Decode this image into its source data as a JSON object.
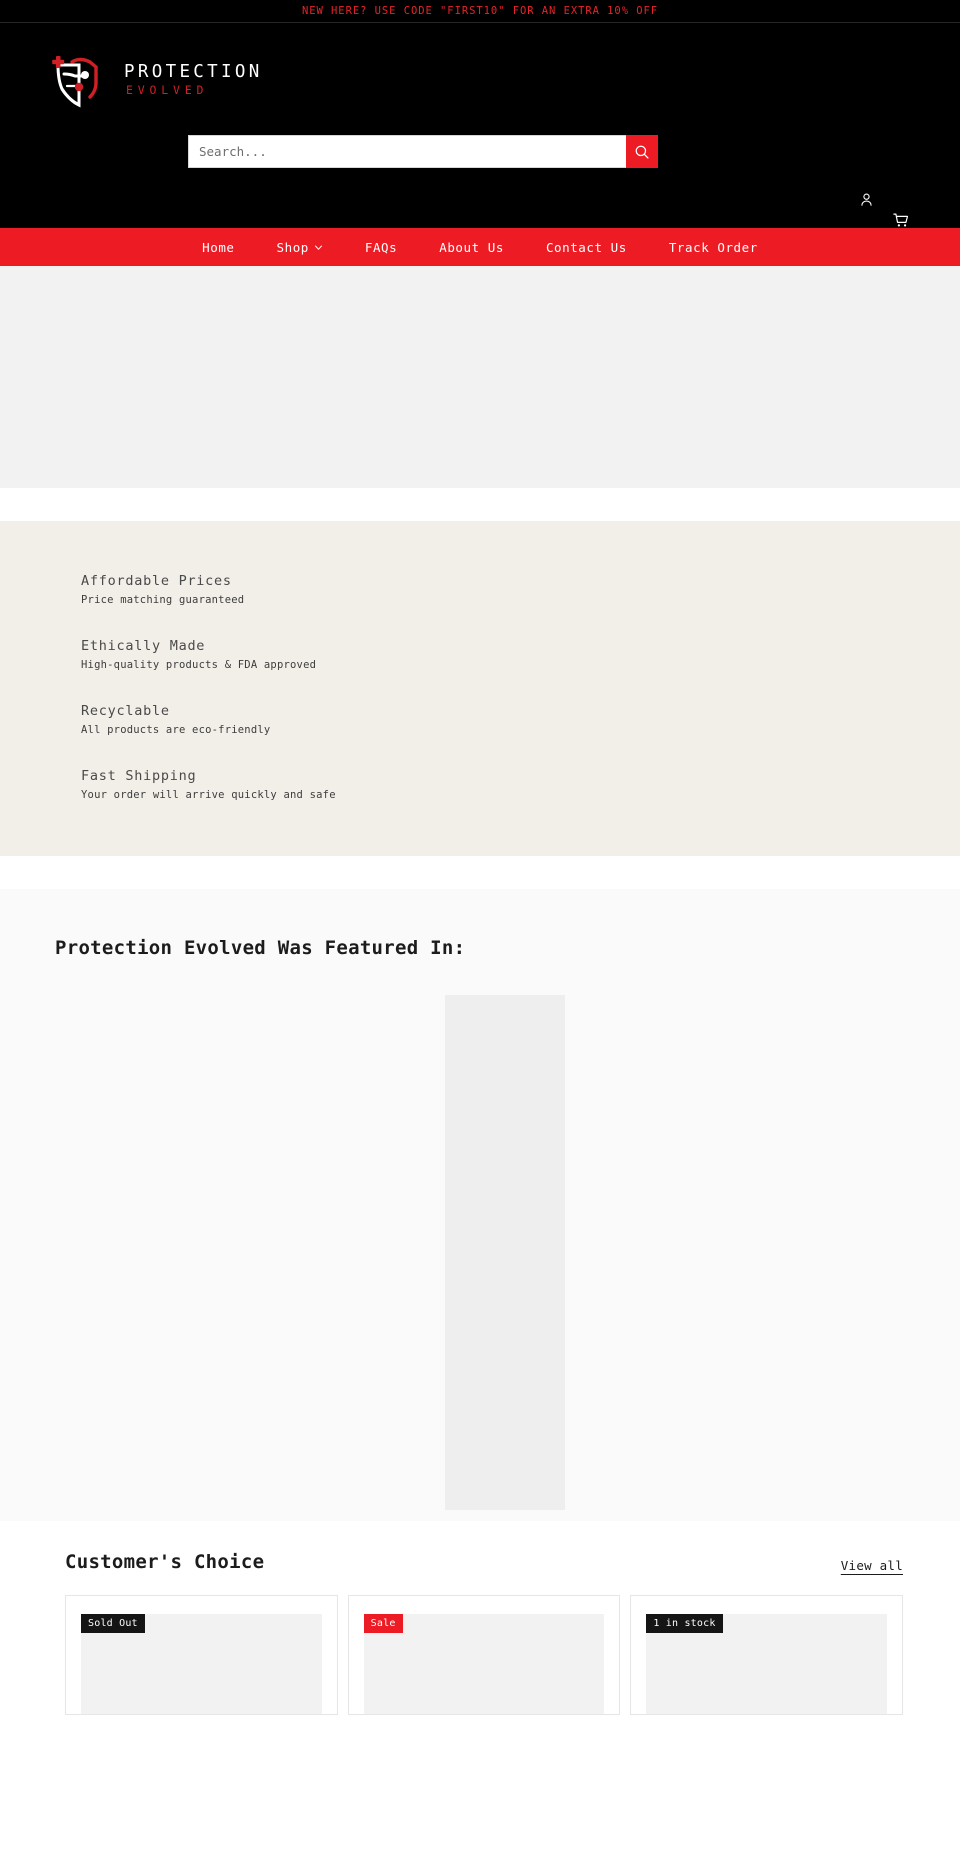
{
  "announcement": {
    "text": "NEW HERE? USE CODE \"FIRST10\" FOR AN EXTRA 10% OFF",
    "color": "#e8232a"
  },
  "brand": {
    "name_main": "PROTECTION",
    "name_sub": "EVOLVED",
    "logo_icon": "shield-cross-logo",
    "accent_color": "#ed1c24"
  },
  "search": {
    "placeholder": "Search...",
    "value": "",
    "button_icon": "search-icon",
    "button_color": "#ed1c24"
  },
  "header_icons": {
    "account_icon": "person-icon",
    "cart_icon": "shopping-cart-icon"
  },
  "nav": {
    "background": "#ed1c24",
    "items": [
      {
        "label": "Home",
        "has_dropdown": false
      },
      {
        "label": "Shop",
        "has_dropdown": true,
        "icon": "chevron-down-icon"
      },
      {
        "label": "FAQs",
        "has_dropdown": false
      },
      {
        "label": "About Us",
        "has_dropdown": false
      },
      {
        "label": "Contact Us",
        "has_dropdown": false
      },
      {
        "label": "Track Order",
        "has_dropdown": false
      }
    ]
  },
  "hero": {
    "placeholder_color": "#f2f2f2"
  },
  "benefits": {
    "background": "#f2efe9",
    "items": [
      {
        "title": "Affordable Prices",
        "subtitle": "Price matching guaranteed"
      },
      {
        "title": "Ethically Made",
        "subtitle": "High-quality products & FDA approved"
      },
      {
        "title": "Recyclable",
        "subtitle": "All products are eco-friendly"
      },
      {
        "title": "Fast Shipping",
        "subtitle": "Your order will arrive quickly and safe"
      }
    ]
  },
  "featured": {
    "title": "Protection Evolved Was Featured In:",
    "background": "#fafafa",
    "image_placeholder_color": "#eeeeee"
  },
  "customers_choice": {
    "title": "Customer's Choice",
    "view_all_label": "View all",
    "products": [
      {
        "badge": "Sold Out",
        "badge_style": "dark"
      },
      {
        "badge": "Sale",
        "badge_style": "sale"
      },
      {
        "badge": "1 in stock",
        "badge_style": "dark"
      }
    ]
  }
}
